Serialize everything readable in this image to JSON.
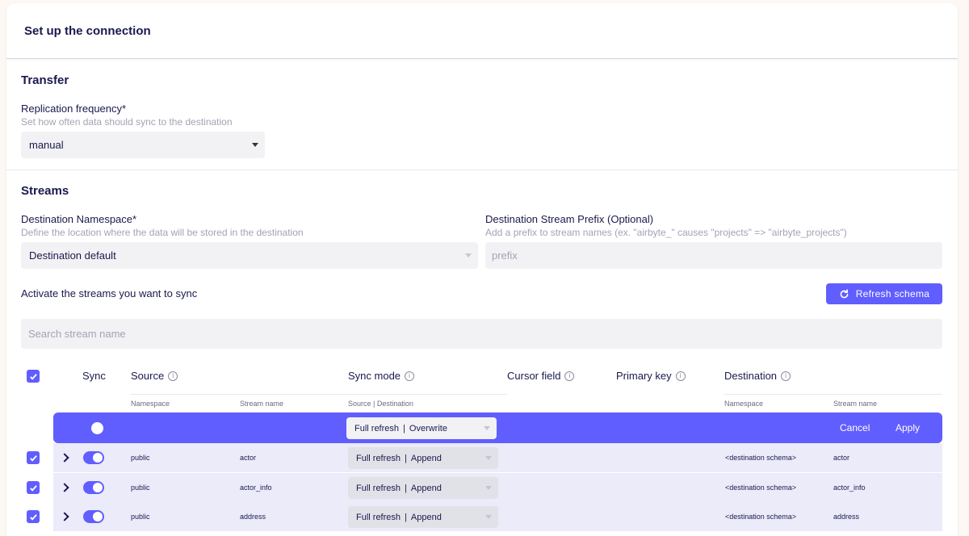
{
  "header": {
    "title": "Set up the connection"
  },
  "transfer": {
    "title": "Transfer",
    "frequency_label": "Replication frequency*",
    "frequency_hint": "Set how often data should sync to the destination",
    "frequency_value": "manual"
  },
  "streams": {
    "title": "Streams",
    "namespace_label": "Destination Namespace*",
    "namespace_hint": "Define the location where the data will be stored in the destination",
    "namespace_value": "Destination default",
    "prefix_label": "Destination Stream Prefix (Optional)",
    "prefix_hint": "Add a prefix to stream names (ex. \"airbyte_\" causes \"projects\" => \"airbyte_projects\")",
    "prefix_placeholder": "prefix",
    "activate_label": "Activate the streams you want to sync",
    "refresh_label": "Refresh schema",
    "search_placeholder": "Search stream name"
  },
  "table": {
    "headers": {
      "sync": "Sync",
      "source": "Source",
      "sync_mode": "Sync mode",
      "cursor_field": "Cursor field",
      "primary_key": "Primary key",
      "destination": "Destination"
    },
    "subheaders": {
      "namespace": "Namespace",
      "stream_name": "Stream name",
      "source_destination": "Source | Destination",
      "dest_namespace": "Namespace",
      "dest_stream_name": "Stream name"
    },
    "bulk": {
      "mode_source": "Full refresh",
      "mode_dest": "Overwrite",
      "cancel": "Cancel",
      "apply": "Apply"
    },
    "rows": [
      {
        "namespace": "public",
        "stream": "actor",
        "mode_source": "Full refresh",
        "mode_dest": "Append",
        "dest_namespace": "<destination schema>",
        "dest_stream": "actor"
      },
      {
        "namespace": "public",
        "stream": "actor_info",
        "mode_source": "Full refresh",
        "mode_dest": "Append",
        "dest_namespace": "<destination schema>",
        "dest_stream": "actor_info"
      },
      {
        "namespace": "public",
        "stream": "address",
        "mode_source": "Full refresh",
        "mode_dest": "Append",
        "dest_namespace": "<destination schema>",
        "dest_stream": "address"
      }
    ]
  },
  "colors": {
    "accent": "#615eff",
    "row_bg": "#ebebfa",
    "text": "#1a194d"
  }
}
